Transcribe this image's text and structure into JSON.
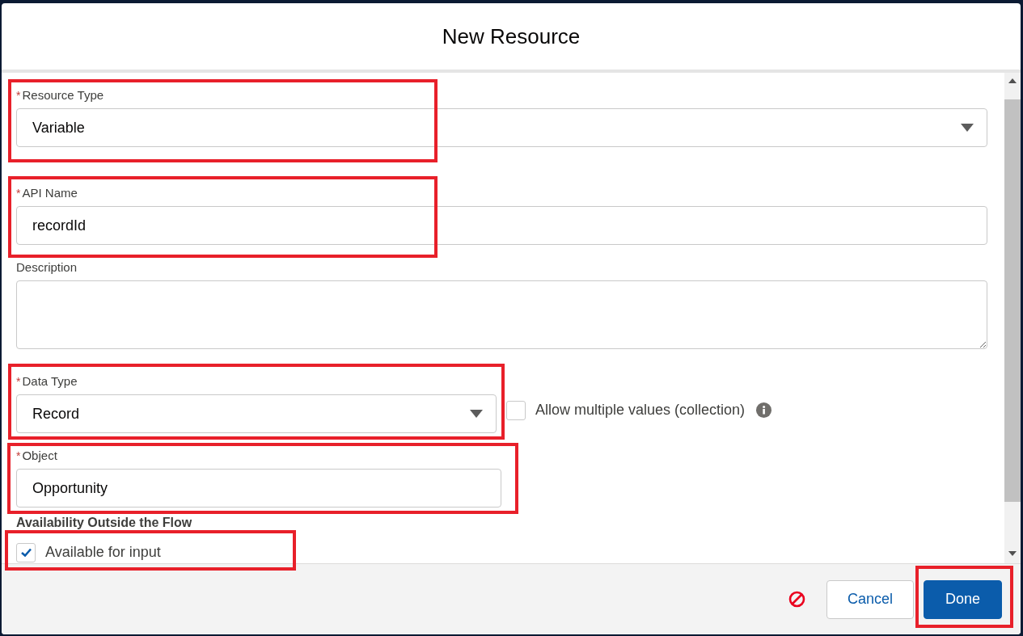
{
  "dialog": {
    "title": "New Resource"
  },
  "fields": [
    {
      "kind": "combobox",
      "label": "Resource Type",
      "required_mark": "*",
      "value": "Variable",
      "highlighted": true
    },
    {
      "kind": "input",
      "label": "API Name",
      "required_mark": "*",
      "value": "recordId",
      "highlighted": true
    },
    {
      "kind": "textarea",
      "label": "Description",
      "highlighted": false
    },
    {
      "kind": "combobox",
      "label": "Data Type",
      "required_mark": "*",
      "value": "Record",
      "highlighted": true,
      "side_checkbox": {
        "label": "Allow multiple values (collection)",
        "checked": false
      }
    },
    {
      "kind": "object-picker",
      "label": "Object",
      "required_mark": "*",
      "value": "Opportunity",
      "highlighted": true
    }
  ],
  "availability": {
    "heading": "Availability Outside the Flow",
    "options": [
      {
        "label": "Available for input",
        "checked": true,
        "highlighted": true
      }
    ]
  },
  "buttons": [
    {
      "label": "Cancel",
      "kind": "neutral",
      "highlighted": false
    },
    {
      "label": "Done",
      "kind": "brand",
      "highlighted": true
    }
  ]
}
